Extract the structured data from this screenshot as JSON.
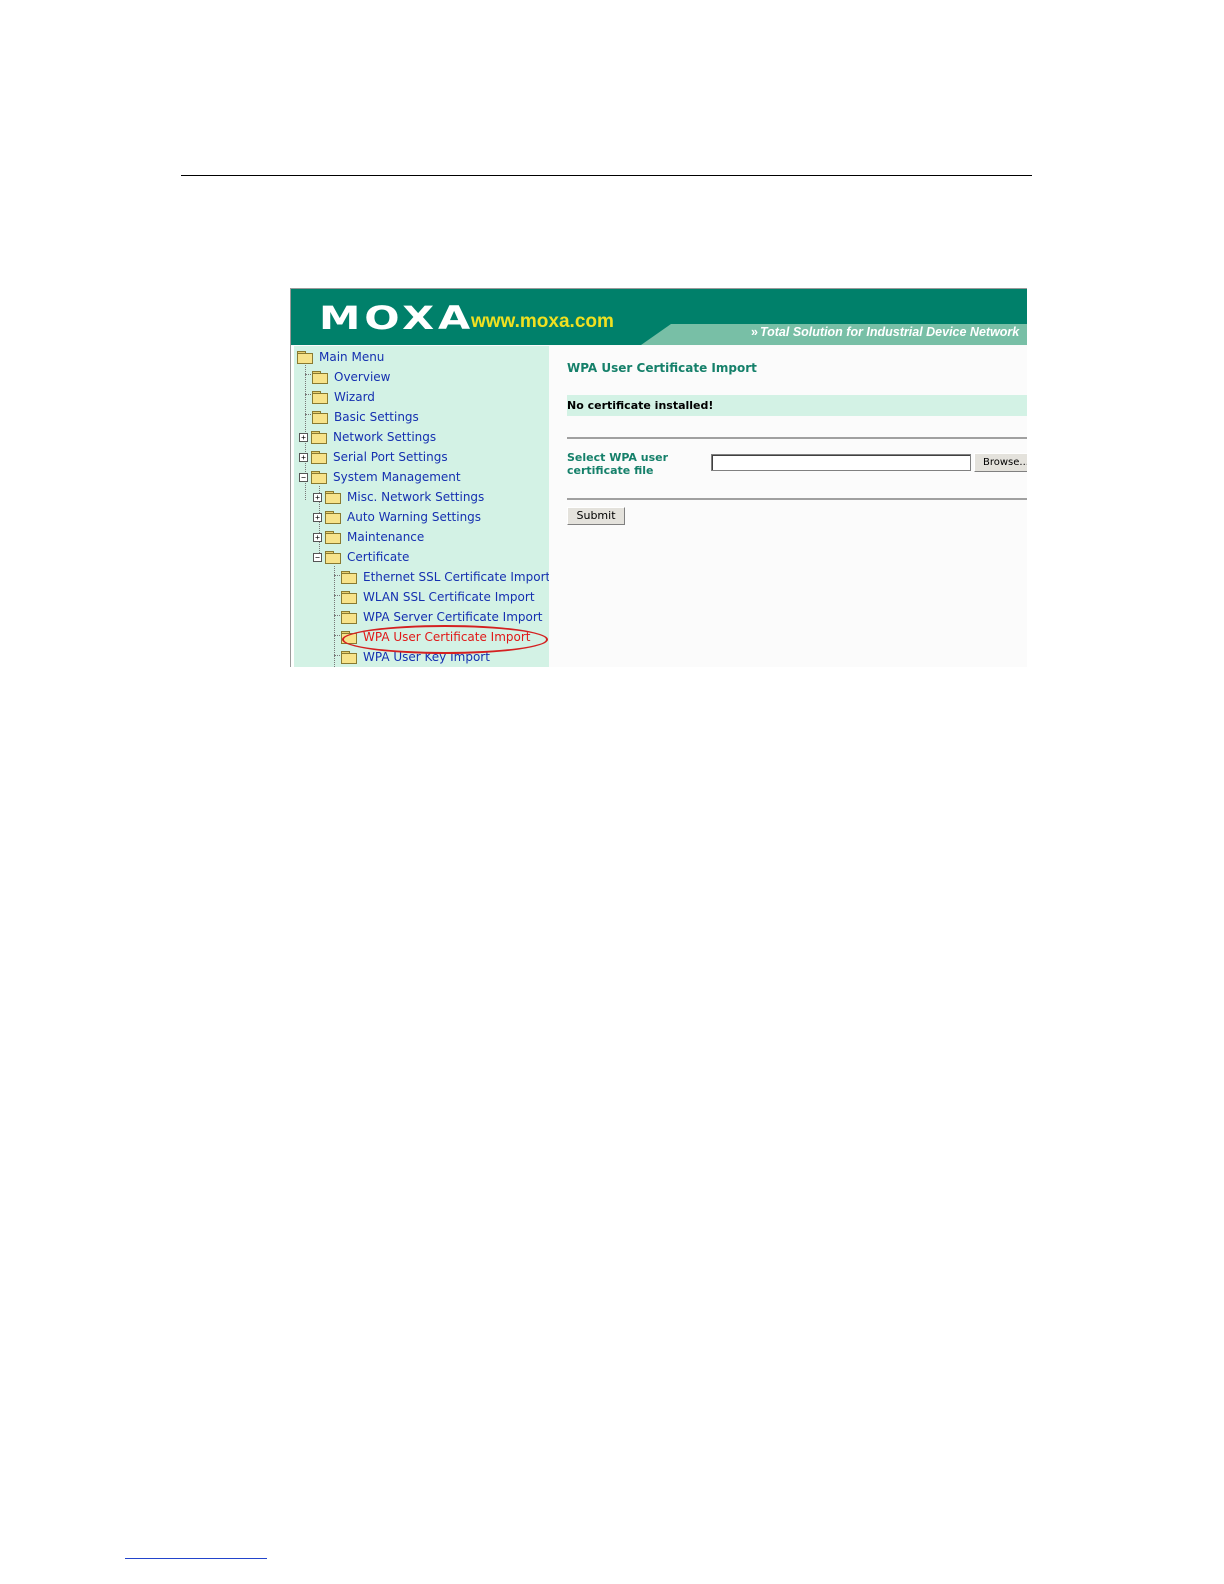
{
  "header": {
    "logo": "MOXA",
    "url": "www.moxa.com",
    "tagline_chevrons": "»",
    "tagline": "Total Solution for Industrial Device Network"
  },
  "sidebar": {
    "items": [
      {
        "label": "Main Menu",
        "expander": ""
      },
      {
        "label": "Overview",
        "expander": ""
      },
      {
        "label": "Wizard",
        "expander": ""
      },
      {
        "label": "Basic Settings",
        "expander": ""
      },
      {
        "label": "Network Settings",
        "expander": "+"
      },
      {
        "label": "Serial Port Settings",
        "expander": "+"
      },
      {
        "label": "System Management",
        "expander": "−"
      },
      {
        "label": "Misc. Network Settings",
        "expander": "+"
      },
      {
        "label": "Auto Warning Settings",
        "expander": "+"
      },
      {
        "label": "Maintenance",
        "expander": "+"
      },
      {
        "label": "Certificate",
        "expander": "−"
      },
      {
        "label": "Ethernet SSL Certificate Import",
        "expander": ""
      },
      {
        "label": "WLAN SSL Certificate Import",
        "expander": ""
      },
      {
        "label": "WPA Server Certificate Import",
        "expander": ""
      },
      {
        "label": "WPA User Certificate Import",
        "expander": "",
        "active": true
      },
      {
        "label": "WPA User Key Import",
        "expander": ""
      }
    ]
  },
  "main": {
    "title": "WPA User Certificate Import",
    "status": "No certificate installed!",
    "field_label": "Select WPA user certificate file",
    "file_value": "",
    "browse_label": "Browse...",
    "submit_label": "Submit"
  },
  "colors": {
    "header_green": "#00806a",
    "sidebar_bg": "#d3f2e5",
    "link_blue": "#1530b0",
    "active_red": "#e01818",
    "title_green": "#15806a",
    "url_yellow": "#f0e020"
  }
}
